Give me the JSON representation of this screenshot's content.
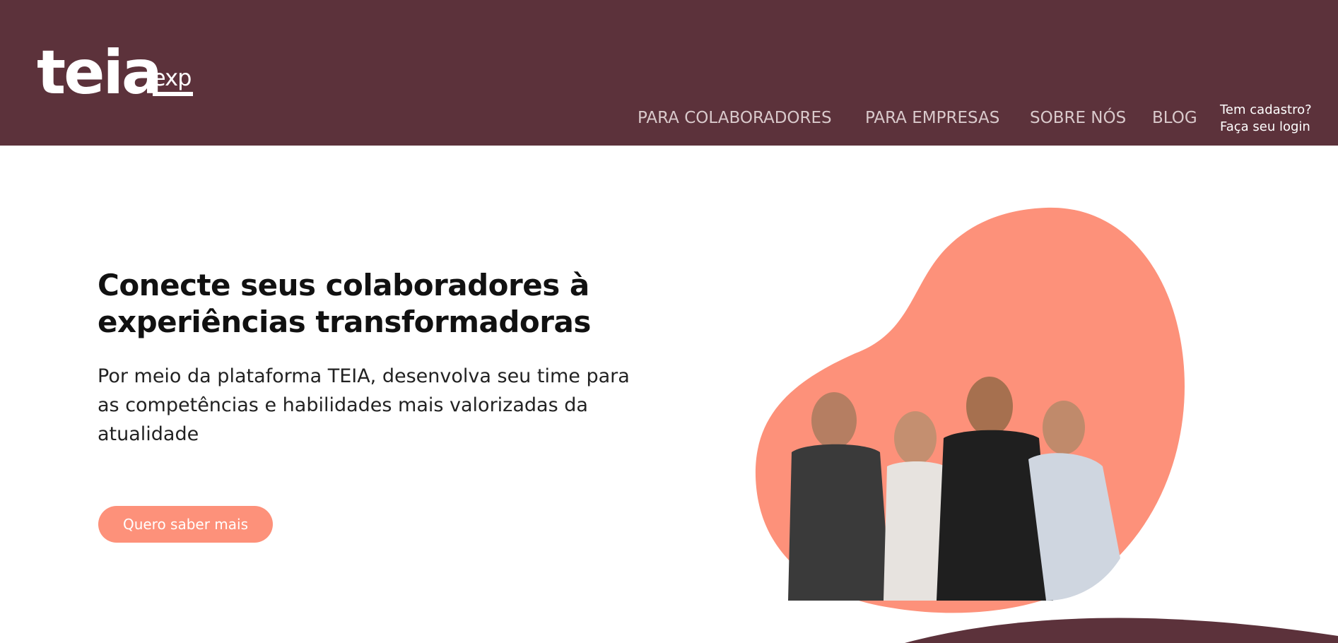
{
  "header": {
    "logo_main": "teia",
    "logo_sub": "exp",
    "nav": [
      {
        "label": "PARA COLABORADORES"
      },
      {
        "label": "PARA EMPRESAS"
      },
      {
        "label": "SOBRE NÓS"
      },
      {
        "label": "BLOG"
      }
    ],
    "login_line1": "Tem cadastro?",
    "login_line2": "Faça seu login"
  },
  "hero": {
    "title": "Conecte seus colaboradores à experiências transformadoras",
    "subtitle": "Por meio da plataforma TEIA, desenvolva seu time para as competências e habilidades mais valorizadas da atualidade",
    "cta_label": "Quero saber mais"
  },
  "colors": {
    "header_bg": "#5c323b",
    "accent": "#fd917a",
    "blob": "#fd917a"
  }
}
